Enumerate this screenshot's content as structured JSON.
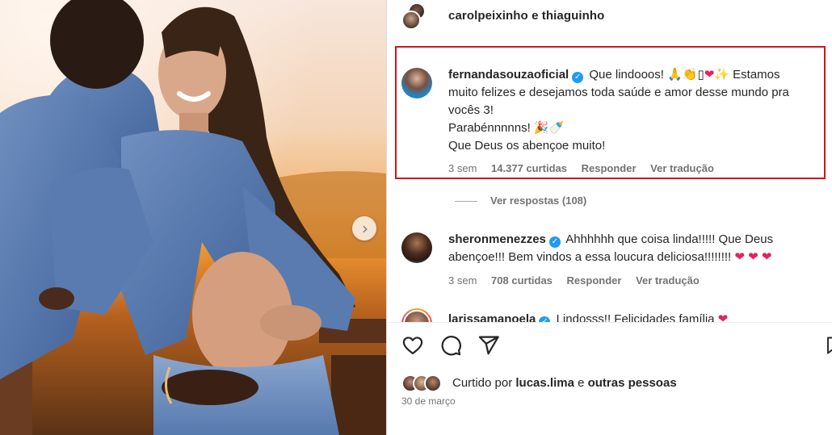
{
  "post": {
    "header_title": "carolpeixinho e thiaguinho",
    "colors": {
      "highlight": "#d3131c",
      "verified": "#1f9bf0",
      "muted": "#737373",
      "text": "#262626"
    }
  },
  "comments": [
    {
      "username": "fernandasouzaoficial",
      "verified": true,
      "lines": [
        "Que lindooos! 🙏👏▯❤✨ Estamos",
        "muito felizes e desejamos toda saúde e amor desse mundo pra",
        "vocês 3!",
        "Parabénnnnns! 🎉🍼",
        "Que Deus os abençoe muito!"
      ],
      "time": "3 sem",
      "likes": "14.377 curtidas",
      "reply": "Responder",
      "translate": "Ver tradução",
      "view_replies": "Ver respostas (108)"
    },
    {
      "username": "sheronmenezzes",
      "verified": true,
      "lines": [
        "Ahhhhhh que coisa linda!!!!! Que Deus",
        "abençoe!!! Bem vindos a essa loucura deliciosa!!!!!!!! ❤ ❤ ❤"
      ],
      "time": "3 sem",
      "likes": "708 curtidas",
      "reply": "Responder",
      "translate": "Ver tradução"
    },
    {
      "username": "larissamanoela",
      "verified": true,
      "lines": [
        "Lindosss!! Felicidades família ❤"
      ]
    }
  ],
  "actions": {
    "icons": [
      "heart-icon",
      "comment-icon",
      "share-icon",
      "bookmark-icon"
    ]
  },
  "likes": {
    "prefix": "Curtido por",
    "user": "lucas.lima",
    "connector": "e",
    "others": "outras pessoas"
  },
  "date": "30 de março",
  "photo": {
    "next_icon": "chevron-right-icon",
    "next_glyph": "›"
  }
}
